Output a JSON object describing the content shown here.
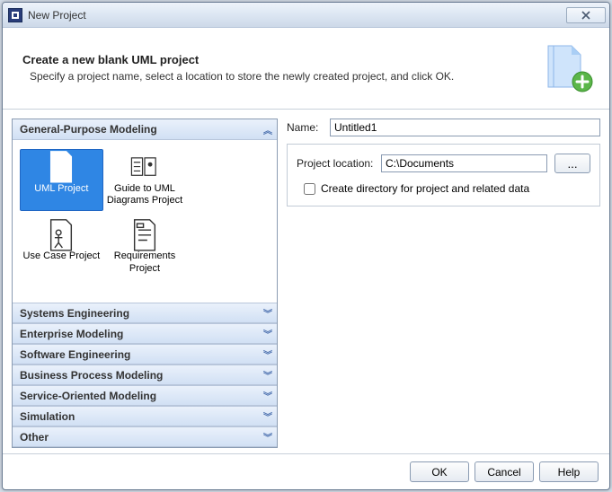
{
  "window": {
    "title": "New Project"
  },
  "header": {
    "title": "Create a new blank UML project",
    "subtitle": "Specify a project name, select a location to store the newly created project, and click OK."
  },
  "categories": {
    "expanded": {
      "label": "General-Purpose Modeling",
      "items": [
        {
          "label": "UML Project",
          "selected": true
        },
        {
          "label": "Guide to UML Diagrams Project"
        },
        {
          "label": "Use Case Project"
        },
        {
          "label": "Requirements Project"
        }
      ]
    },
    "collapsed": [
      "Systems Engineering",
      "Enterprise Modeling",
      "Software Engineering",
      "Business Process Modeling",
      "Service-Oriented Modeling",
      "Simulation",
      "Other"
    ]
  },
  "form": {
    "name_label": "Name:",
    "name_value": "Untitled1",
    "location_label": "Project location:",
    "location_value": "C:\\Documents",
    "browse_label": "...",
    "checkbox_label": "Create directory for project and related data",
    "checkbox_checked": false
  },
  "footer": {
    "ok": "OK",
    "cancel": "Cancel",
    "help": "Help"
  }
}
